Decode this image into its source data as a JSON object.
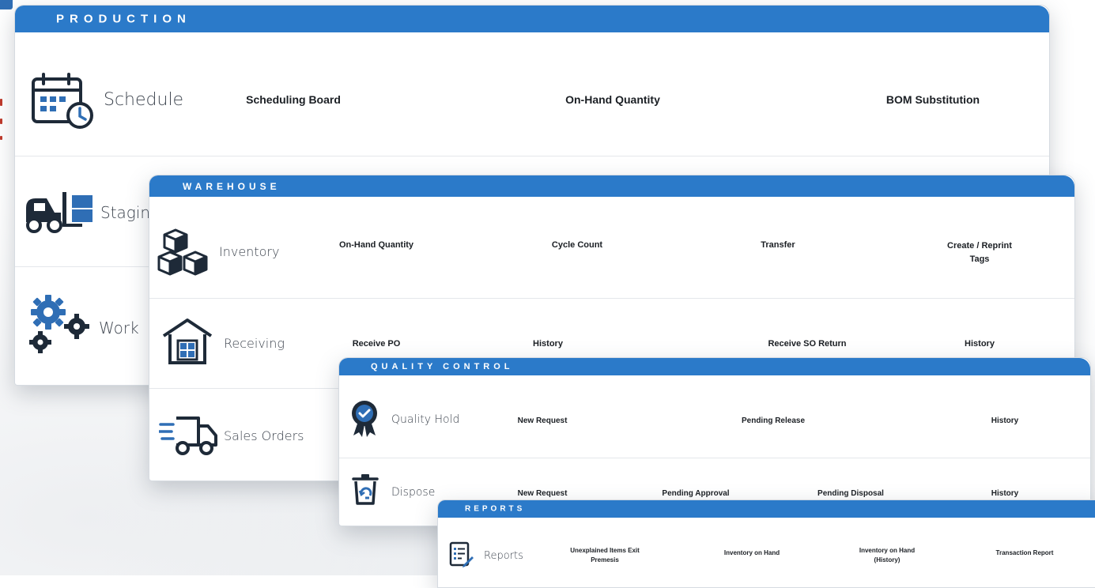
{
  "production": {
    "title": "PRODUCTION",
    "rows": [
      {
        "label": "Schedule",
        "links": [
          "Scheduling Board",
          "On-Hand Quantity",
          "BOM Substitution"
        ]
      },
      {
        "label": "Staging"
      },
      {
        "label": "Work"
      }
    ]
  },
  "warehouse": {
    "title": "WAREHOUSE",
    "rows": [
      {
        "label": "Inventory",
        "links": [
          "On-Hand Quantity",
          "Cycle Count",
          "Transfer",
          "Create / Reprint Tags"
        ]
      },
      {
        "label": "Receiving",
        "links": [
          "Receive PO",
          "History",
          "Receive SO Return",
          "History"
        ]
      },
      {
        "label": "Sales Orders"
      }
    ]
  },
  "quality_control": {
    "title": "QUALITY CONTROL",
    "rows": [
      {
        "label": "Quality Hold",
        "links": [
          "New Request",
          "Pending Release",
          "History"
        ]
      },
      {
        "label": "Dispose",
        "links": [
          "New Request",
          "Pending Approval",
          "Pending Disposal",
          "History"
        ]
      }
    ]
  },
  "reports": {
    "title": "REPORTS",
    "rows": [
      {
        "label": "Reports",
        "links": [
          "Unexplained Items Exit Premesis",
          "Inventory on Hand",
          "Inventory on Hand (History)",
          "Transaction Report"
        ]
      }
    ]
  },
  "colors": {
    "header": "#2b7ac9",
    "icon": "#1e2a38",
    "icon_accent": "#2f6eb5"
  }
}
